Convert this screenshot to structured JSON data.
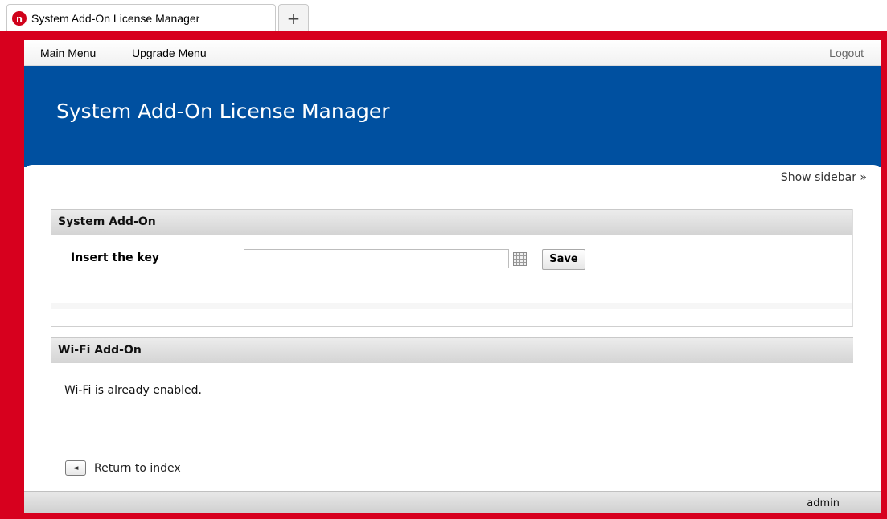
{
  "browser": {
    "tab_title": "System Add-On License Manager",
    "new_tab_label": "+",
    "tab_icon_letter": "n"
  },
  "nav": {
    "main_menu": "Main Menu",
    "upgrade_menu": "Upgrade Menu",
    "logout": "Logout"
  },
  "banner": {
    "title": "System Add-On License Manager"
  },
  "sidebar_toggle": "Show sidebar »",
  "system_addon": {
    "header": "System Add-On",
    "key_label": "Insert the key",
    "key_value": "",
    "save_label": "Save"
  },
  "wifi_addon": {
    "header": "Wi-Fi Add-On",
    "status_text": "Wi-Fi is already enabled."
  },
  "return_link": {
    "icon": "◄",
    "label": "Return to index"
  },
  "footer": {
    "user": "admin"
  },
  "colors": {
    "frame_red": "#d7001e",
    "banner_blue": "#0050a0"
  }
}
